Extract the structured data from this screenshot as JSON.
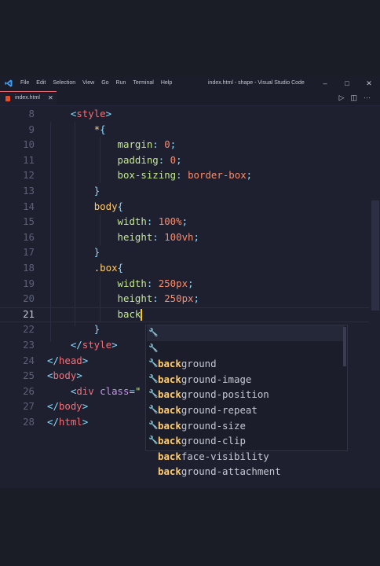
{
  "window": {
    "title": "index.html - shape - Visual Studio Code",
    "menu": [
      "File",
      "Edit",
      "Selection",
      "View",
      "Go",
      "Run",
      "Terminal",
      "Help"
    ],
    "controls": {
      "minimize": "–",
      "maximize": "□",
      "close": "✕"
    }
  },
  "tab": {
    "name": "index.html",
    "close": "✕"
  },
  "editor_actions": {
    "run": "▷",
    "split": "◫",
    "more": "···"
  },
  "code_lines": [
    {
      "num": "8"
    },
    {
      "num": "9"
    },
    {
      "num": "10"
    },
    {
      "num": "11"
    },
    {
      "num": "12"
    },
    {
      "num": "13"
    },
    {
      "num": "14"
    },
    {
      "num": "15"
    },
    {
      "num": "16"
    },
    {
      "num": "17"
    },
    {
      "num": "18"
    },
    {
      "num": "19"
    },
    {
      "num": "20"
    },
    {
      "num": "21"
    },
    {
      "num": "22"
    },
    {
      "num": "23"
    },
    {
      "num": "24"
    },
    {
      "num": "25"
    },
    {
      "num": "26"
    },
    {
      "num": "27"
    },
    {
      "num": "28"
    }
  ],
  "code": {
    "l8": {
      "open": "<",
      "tag": "style",
      "close": ">"
    },
    "l9": {
      "sel": "*",
      "brace": "{"
    },
    "l10": {
      "prop": "margin",
      "colon": ": ",
      "val": "0",
      "semi": ";"
    },
    "l11": {
      "prop": "padding",
      "colon": ": ",
      "val": "0",
      "semi": ";"
    },
    "l12": {
      "prop": "box-sizing",
      "colon": ": ",
      "val": "border-box",
      "semi": ";"
    },
    "l13": {
      "brace": "}"
    },
    "l14": {
      "sel": "body",
      "brace": "{"
    },
    "l15": {
      "prop": "width",
      "colon": ": ",
      "val": "100%",
      "semi": ";"
    },
    "l16": {
      "prop": "height",
      "colon": ": ",
      "val": "100vh",
      "semi": ";"
    },
    "l17": {
      "brace": "}"
    },
    "l18": {
      "sel": ".box",
      "brace": "{"
    },
    "l19": {
      "prop": "width",
      "colon": ": ",
      "val": "250px",
      "semi": ";"
    },
    "l20": {
      "prop": "height",
      "colon": ": ",
      "val": "250px",
      "semi": ";"
    },
    "l21": {
      "typed": "back"
    },
    "l22": {
      "brace": "}"
    },
    "l23": {
      "open": "</",
      "tag": "style",
      "close": ">"
    },
    "l24": {
      "open": "</",
      "tag": "head",
      "close": ">"
    },
    "l25": {
      "open": "<",
      "tag": "body",
      "close": ">"
    },
    "l26": {
      "open": "<",
      "tag": "div",
      "attr": " class",
      "eq": "=",
      "str": "\""
    },
    "l27": {
      "open": "</",
      "tag": "body",
      "close": ">"
    },
    "l28": {
      "open": "</",
      "tag": "html",
      "close": ">"
    }
  },
  "suggestions": {
    "match": "back",
    "items": [
      {
        "match": "back",
        "rest": "ground"
      },
      {
        "match": "back",
        "rest": "ground-image"
      },
      {
        "match": "back",
        "rest": "ground-position"
      },
      {
        "match": "back",
        "rest": "ground-repeat"
      },
      {
        "match": "back",
        "rest": "ground-size"
      },
      {
        "match": "back",
        "rest": "ground-clip"
      },
      {
        "match": "back",
        "rest": "face-visibility"
      },
      {
        "match": "back",
        "rest": "ground-attachment"
      }
    ],
    "icon": "🔧"
  }
}
